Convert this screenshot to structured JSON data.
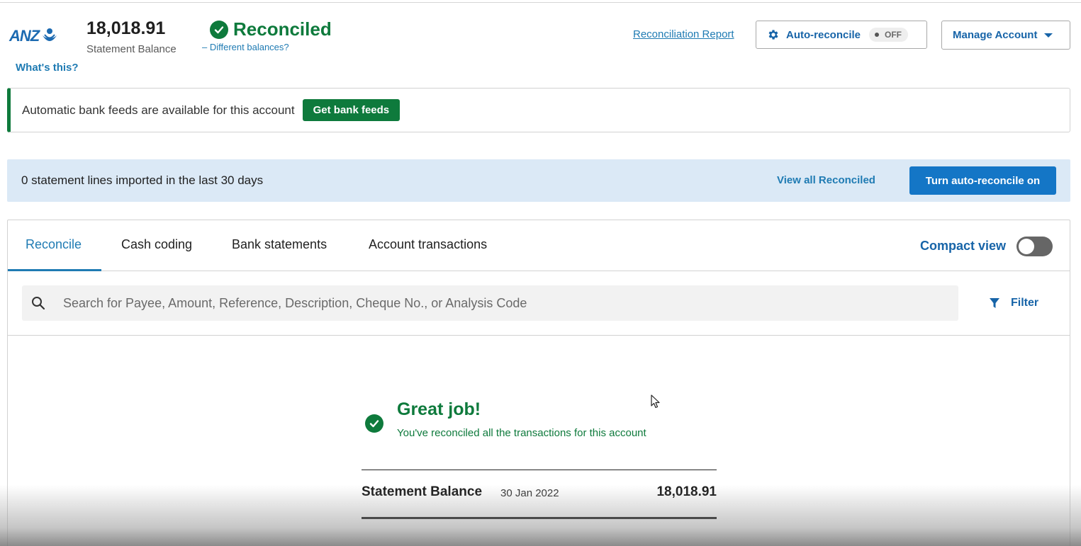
{
  "header": {
    "bank_logo_text": "ANZ",
    "statement_balance": "18,018.91",
    "statement_balance_label": "Statement Balance",
    "whats_this": "What's this?",
    "status": "Reconciled",
    "different_balances_prefix": "–",
    "different_balances": "Different balances?",
    "reconciliation_report": "Reconciliation Report",
    "auto_reconcile_label": "Auto-reconcile",
    "auto_reconcile_state": "OFF",
    "manage_account": "Manage Account"
  },
  "feeds_banner": {
    "text": "Automatic bank feeds are available for this account",
    "button": "Get bank feeds"
  },
  "info_bar": {
    "text": "0 statement lines imported in the last 30 days",
    "view_all": "View all Reconciled",
    "turn_on": "Turn auto-reconcile on"
  },
  "tabs": [
    {
      "label": "Reconcile",
      "active": true
    },
    {
      "label": "Cash coding",
      "active": false
    },
    {
      "label": "Bank statements",
      "active": false
    },
    {
      "label": "Account transactions",
      "active": false
    }
  ],
  "compact_view": {
    "label": "Compact view",
    "on": false
  },
  "search": {
    "placeholder": "Search for Payee, Amount, Reference, Description, Cheque No., or Analysis Code",
    "value": ""
  },
  "filter_label": "Filter",
  "empty_state": {
    "title": "Great job!",
    "subtitle": "You've reconciled all the transactions for this account",
    "balance_label": "Statement Balance",
    "balance_date": "30 Jan 2022",
    "balance_value": "18,018.91"
  },
  "colors": {
    "brand_blue": "#1764a8",
    "link_blue": "#1f7bb3",
    "success_green": "#0e7a3c",
    "primary_button": "#1476c6",
    "info_bg": "#dbe9f6"
  },
  "icons": [
    "anz-logo-icon",
    "check-circle-icon",
    "gear-icon",
    "chevron-down-icon",
    "search-icon",
    "filter-icon",
    "mouse-cursor-icon"
  ]
}
